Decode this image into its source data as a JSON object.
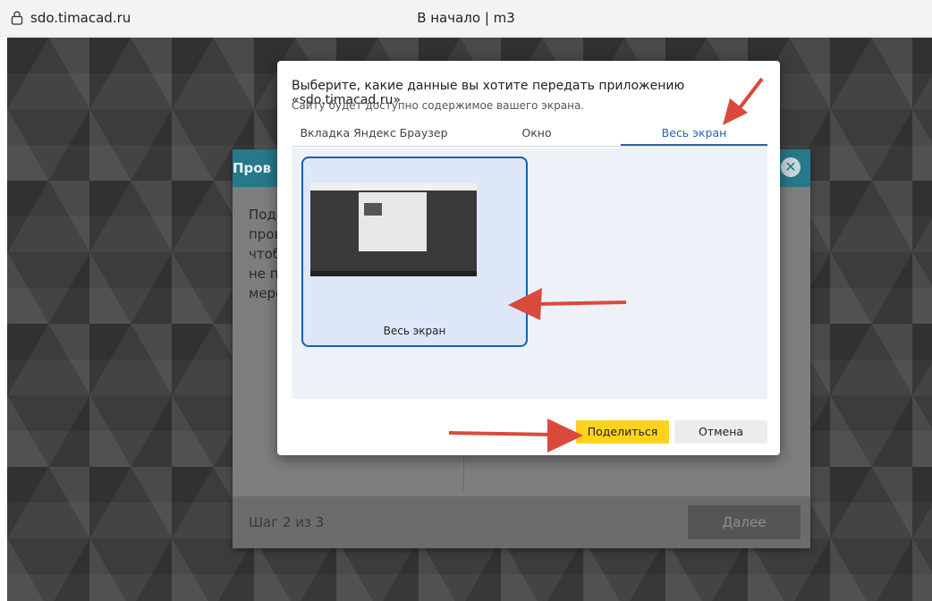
{
  "browser": {
    "url": "sdo.timacad.ru",
    "page_title": "В начало | m3"
  },
  "modal": {
    "title_visible": "Пров",
    "body_lines": [
      "Подс",
      "пров",
      "чтоб",
      "не по",
      "меро"
    ],
    "step_text": "Шаг 2 из 3",
    "next_label": "Далее"
  },
  "share_dialog": {
    "title": "Выберите, какие данные вы хотите передать приложению «sdo.timacad.ru»",
    "subtitle": "Сайту будет доступно содержимое вашего экрана.",
    "tabs": [
      {
        "label": "Вкладка Яндекс Браузер",
        "active": false
      },
      {
        "label": "Окно",
        "active": false
      },
      {
        "label": "Весь экран",
        "active": true
      }
    ],
    "thumbnail_label": "Весь экран",
    "share_label": "Поделиться",
    "cancel_label": "Отмена"
  },
  "colors": {
    "accent": "#2a62b5",
    "share_button": "#ffd21f",
    "modal_header": "#27788a",
    "annotation_arrow": "#d94a3d"
  }
}
